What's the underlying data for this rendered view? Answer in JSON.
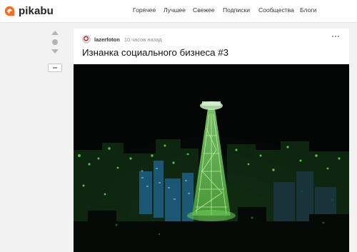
{
  "brand": {
    "name": "pikabu",
    "accent": "#ff6a1a"
  },
  "nav": {
    "items": [
      {
        "label": "Горячее"
      },
      {
        "label": "Лучшее"
      },
      {
        "label": "Свежее"
      },
      {
        "label": "Подписки"
      },
      {
        "label": "Сообщества"
      },
      {
        "label": "Блоги"
      }
    ]
  },
  "post": {
    "author": "lazerfoton",
    "time": "10 часов назад",
    "title": "Изнанка социального бизнеса #3"
  },
  "icons": {
    "logo": "pikabu-logo-icon",
    "vote_up": "vote-up-icon",
    "vote_down": "vote-down-icon",
    "more": "more-dots-icon"
  }
}
